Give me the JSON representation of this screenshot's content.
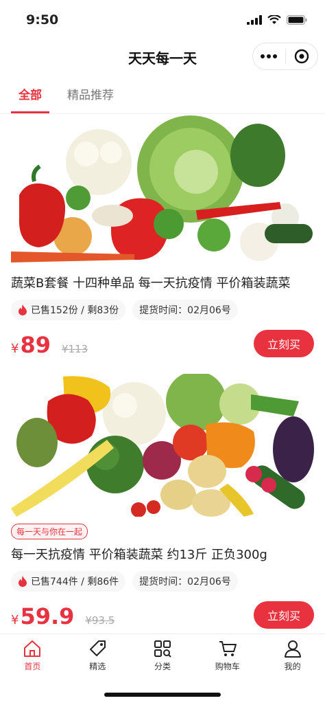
{
  "status": {
    "time": "9:50"
  },
  "nav": {
    "title": "天天每一天"
  },
  "tabs": [
    {
      "label": "全部",
      "active": true
    },
    {
      "label": "精品推荐",
      "active": false
    }
  ],
  "products": [
    {
      "title": "蔬菜B套餐 十四种单品 每一天抗疫情 平价箱装蔬菜",
      "sold": "已售152份 / 剩83份",
      "pickup": "提货时间：02月06号",
      "currency": "¥",
      "price": "89",
      "old_price": "¥113",
      "buy_label": "立刻买"
    },
    {
      "tag": "每一天与你在一起",
      "title": "每一天抗疫情 平价箱装蔬菜 约13斤 正负300g",
      "sold": "已售744件 / 剩86件",
      "pickup": "提货时间：02月06号",
      "currency": "¥",
      "price": "59.9",
      "old_price": "¥93.5",
      "buy_label": "立刻买"
    }
  ],
  "tabbar": [
    {
      "label": "首页",
      "icon": "home-icon",
      "active": true
    },
    {
      "label": "精选",
      "icon": "tag-icon",
      "active": false
    },
    {
      "label": "分类",
      "icon": "category-icon",
      "active": false
    },
    {
      "label": "购物车",
      "icon": "cart-icon",
      "active": false
    },
    {
      "label": "我的",
      "icon": "user-icon",
      "active": false
    }
  ],
  "colors": {
    "accent": "#e8323f",
    "pill_bg": "#f7f7f7"
  }
}
